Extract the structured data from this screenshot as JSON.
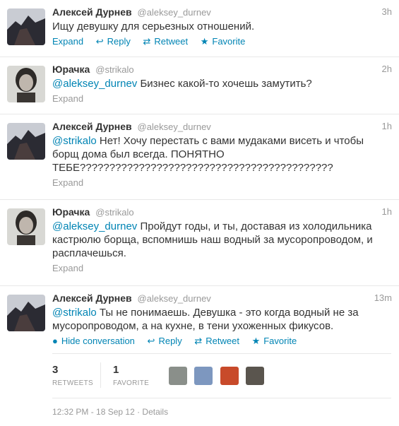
{
  "tweets": [
    {
      "name": "Алексей Дурнев",
      "handle": "@aleksey_durnev",
      "time": "3h",
      "text": "Ищу девушку для серьезных отношений.",
      "expand": "Expand",
      "reply": "Reply",
      "retweet": "Retweet",
      "favorite": "Favorite"
    },
    {
      "name": "Юрачка",
      "handle": "@strikalo",
      "time": "2h",
      "mention": "@aleksey_durnev",
      "text": " Бизнес какой-то хочешь замутить?",
      "expand": "Expand"
    },
    {
      "name": "Алексей Дурнев",
      "handle": "@aleksey_durnev",
      "time": "1h",
      "mention": "@strikalo",
      "text": " Нет! Хочу перестать с вами мудаками висеть и чтобы борщ дома был всегда. ПОНЯТНО ТЕБЕ???????????????????????????????????????????",
      "expand": "Expand"
    },
    {
      "name": "Юрачка",
      "handle": "@strikalo",
      "time": "1h",
      "mention": "@aleksey_durnev",
      "text": " Пройдут годы, и ты, доставая из холодильника кастрюлю борща, вспомнишь наш водный за мусоропроводом, и расплачешься.",
      "expand": "Expand"
    },
    {
      "name": "Алексей Дурнев",
      "handle": "@aleksey_durnev",
      "time": "13m",
      "mention": "@strikalo",
      "text": " Ты не понимаешь. Девушка - это когда водный не за мусоропроводом, а на кухне, в тени ухоженных фикусов.",
      "hide": "Hide conversation",
      "reply": "Reply",
      "retweet": "Retweet",
      "favorite": "Favorite"
    }
  ],
  "stats": {
    "retweets_count": "3",
    "retweets_label": "RETWEETS",
    "favorites_count": "1",
    "favorites_label": "FAVORITE"
  },
  "footer": "12:32 PM - 18 Sep 12 · Details",
  "colors": {
    "link": "#0084b4",
    "muted": "#999999",
    "text": "#333333"
  },
  "icons": {
    "reply": "reply-arrow-icon",
    "retweet": "retweet-icon",
    "favorite": "star-icon",
    "conversation": "speech-bubble-icon"
  }
}
